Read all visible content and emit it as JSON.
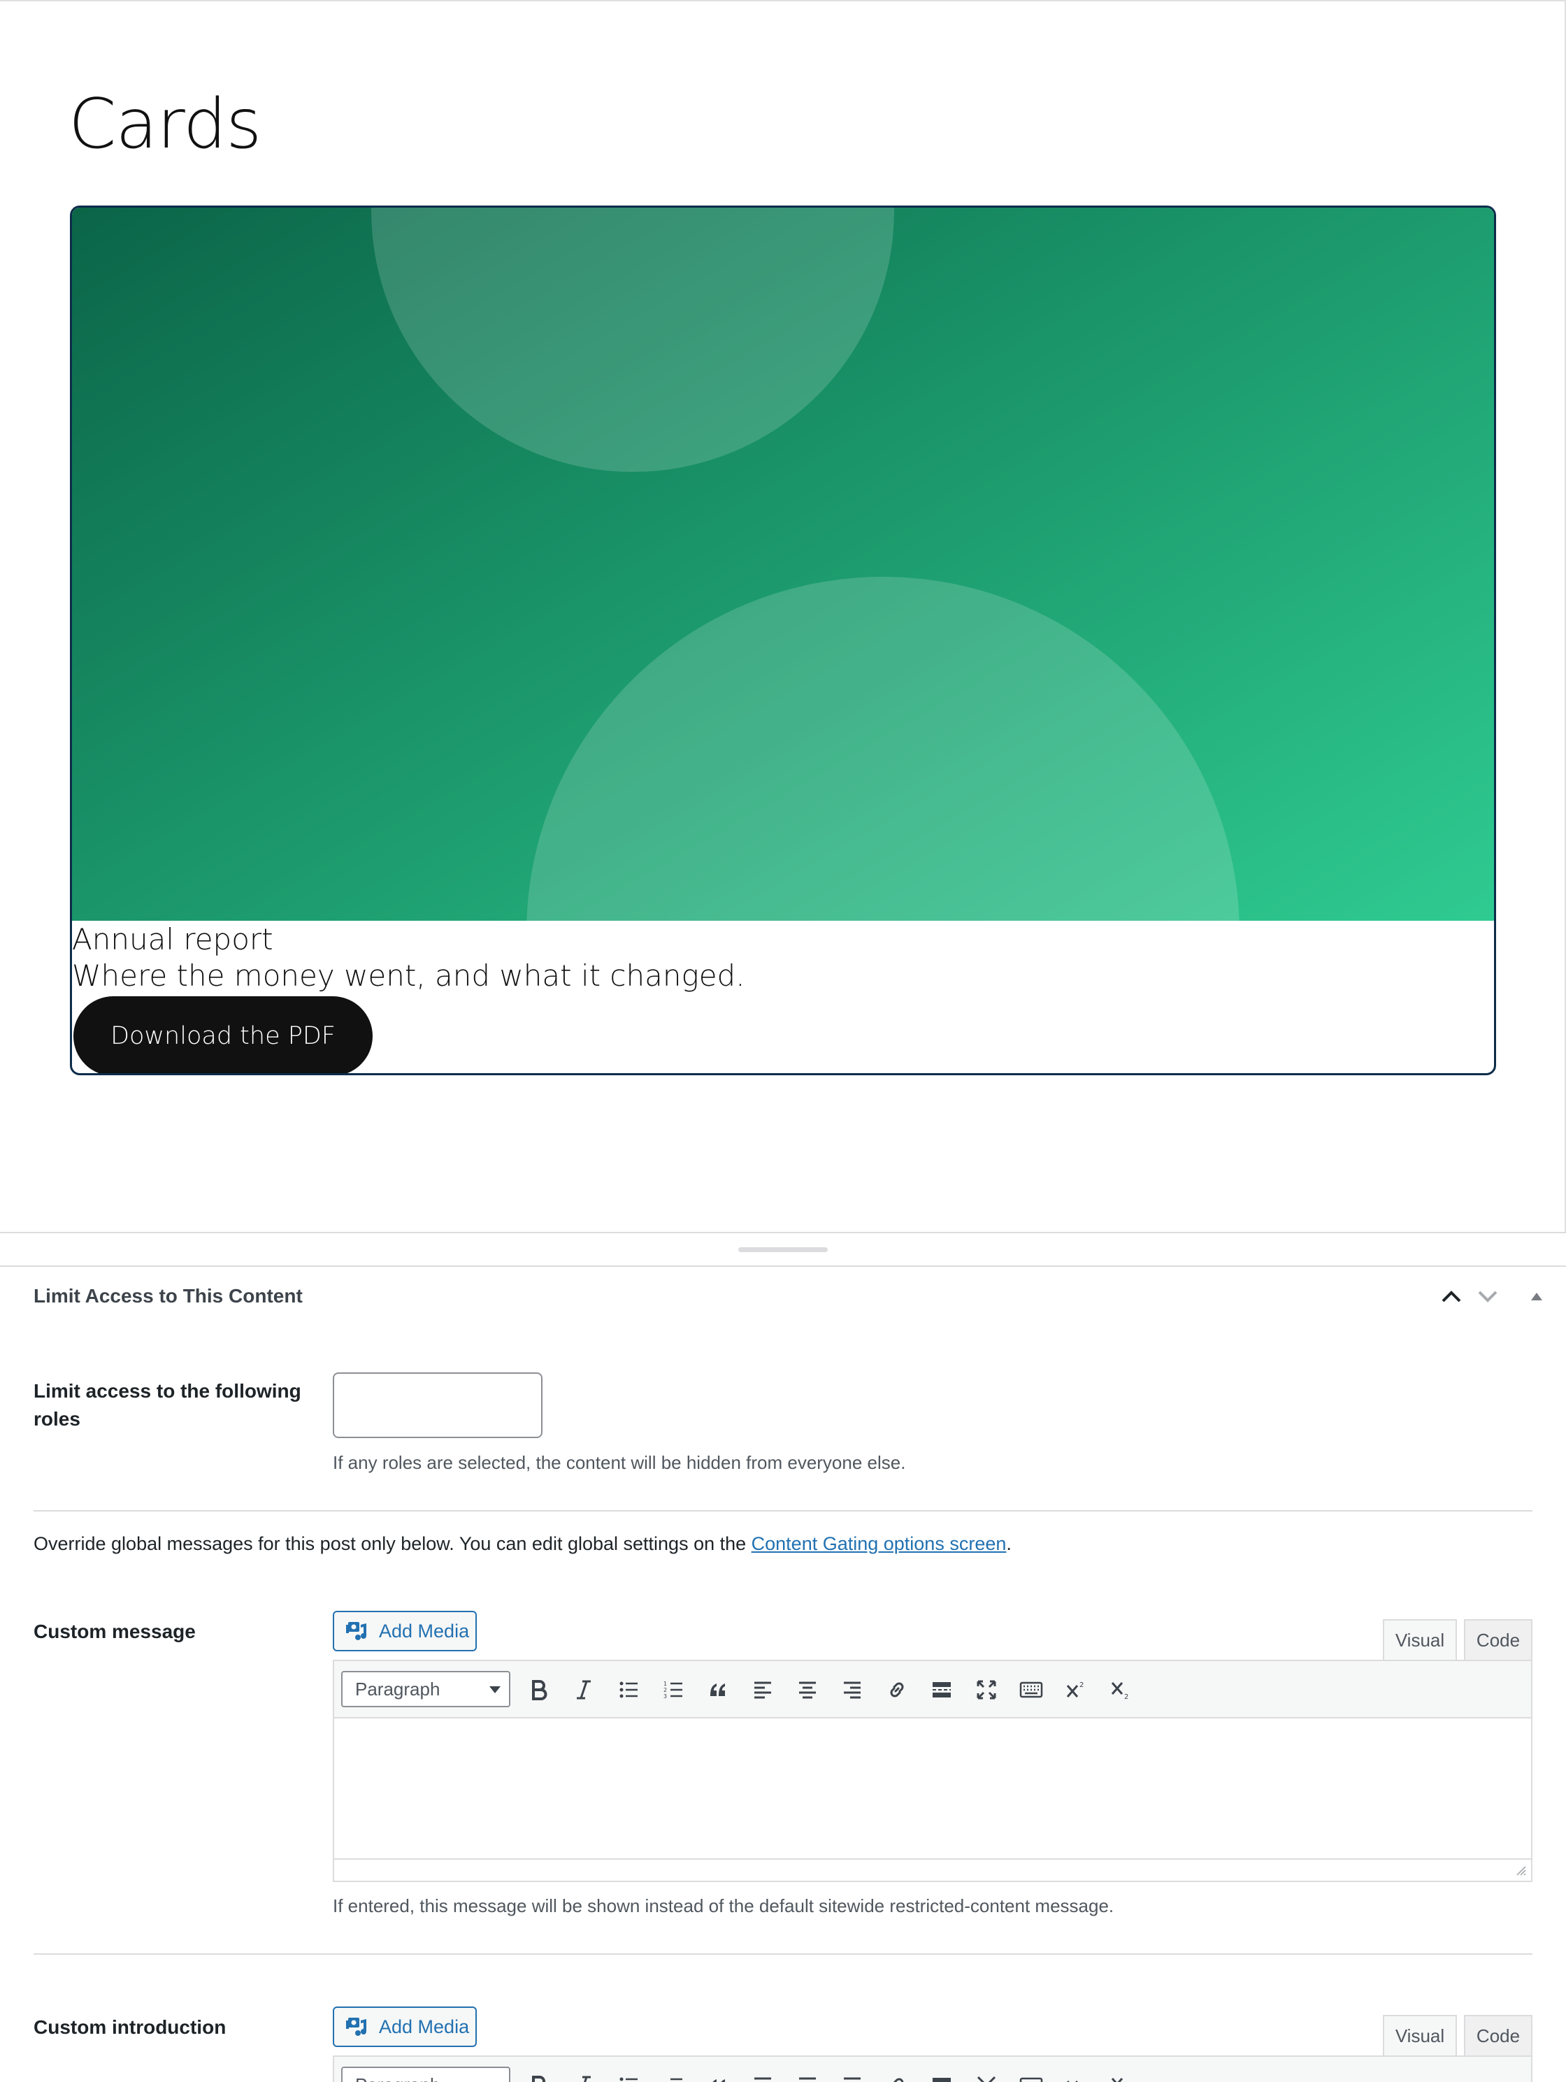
{
  "canvas": {
    "page_title": "Cards",
    "card": {
      "title": "Annual report",
      "text": "Where the money went, and what it changed.",
      "button_label": "Download the PDF"
    }
  },
  "metabox": {
    "title": "Limit Access to This Content",
    "roles": {
      "label": "Limit access to the following roles",
      "value": "",
      "help": "If any roles are selected, the content will be hidden from everyone else."
    },
    "override": {
      "text": "Override global messages for this post only below. You can edit global settings on the ",
      "link_text": "Content Gating options screen",
      "suffix": "."
    },
    "custom_message": {
      "label": "Custom message",
      "add_media": "Add Media",
      "tab_visual": "Visual",
      "tab_code": "Code",
      "format": "Paragraph",
      "help": "If entered, this message will be shown instead of the default sitewide restricted-content message."
    },
    "custom_introduction": {
      "label": "Custom introduction",
      "add_media": "Add Media",
      "tab_visual": "Visual",
      "tab_code": "Code",
      "format": "Paragraph"
    }
  },
  "colors": {
    "accent": "#2271b1",
    "card_border": "#0c2c4a",
    "hero_start": "#0b6548",
    "hero_end": "#2fcb91"
  }
}
